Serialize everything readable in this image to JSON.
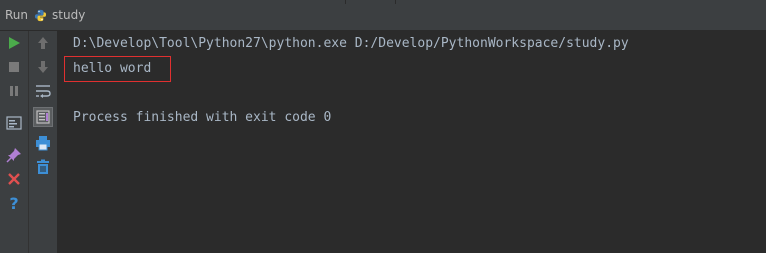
{
  "header": {
    "run_label": "Run",
    "tab_label": "study"
  },
  "toolbar_left": [
    {
      "icon": "run-icon",
      "color": "#4bab4b"
    },
    {
      "icon": "stop-icon",
      "color": "#8b8b8b"
    },
    {
      "icon": "pause-icon",
      "color": "#8b8b8b"
    },
    {
      "icon": "dump-threads-icon",
      "color": "#a9b7c6"
    },
    {
      "icon": "pin-icon",
      "color": "#b07fd4"
    },
    {
      "icon": "close-icon",
      "color": "#e05050"
    },
    {
      "icon": "help-icon",
      "color": "#3d8fd6"
    }
  ],
  "toolbar_right": [
    {
      "icon": "up-arrow-icon"
    },
    {
      "icon": "down-arrow-icon"
    },
    {
      "icon": "soft-wrap-icon"
    },
    {
      "icon": "scroll-to-end-icon"
    },
    {
      "icon": "print-icon"
    },
    {
      "icon": "trash-icon"
    }
  ],
  "console": {
    "command": "D:\\Develop\\Tool\\Python27\\python.exe D:/Develop/PythonWorkspace/study.py",
    "output": "hello word",
    "exit_message": "Process finished with exit code 0"
  },
  "colors": {
    "highlight_border": "#e03030",
    "console_text": "#a9b7c6",
    "background": "#2b2b2b"
  }
}
